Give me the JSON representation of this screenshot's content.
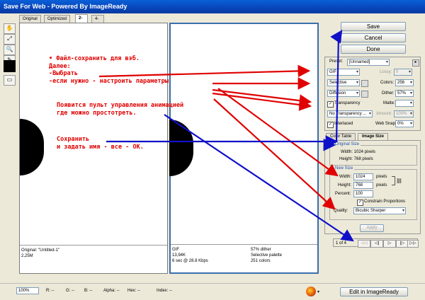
{
  "window": {
    "title": "Save For Web - Powered By ImageReady"
  },
  "tabs": [
    "Original",
    "Optimized",
    "2-Up",
    "4-Up"
  ],
  "left_pane": {
    "caption_line1": "Original: \"Untitled-1\"",
    "caption_line2": "2,25M"
  },
  "right_pane": {
    "caption_left": [
      "GIF",
      "13,94K",
      "6 sec @ 28.8 Kbps"
    ],
    "caption_right": [
      "57% dither",
      "Selective palette",
      "251 colors"
    ]
  },
  "buttons": {
    "save": "Save",
    "cancel": "Cancel",
    "done": "Done"
  },
  "settings": {
    "preset_label": "Preset:",
    "preset_value": "[Unnamed]",
    "format": "GIF",
    "lossy_label": "Lossy:",
    "lossy_value": "0",
    "palette": "Selective",
    "colors_label": "Colors:",
    "colors_value": "256",
    "dither_algo": "Diffusion",
    "dither_label": "Dither:",
    "dither_value": "57%",
    "transparency_label": "Transparency",
    "matte_label": "Matte:",
    "transparency_dither": "No Transparency ...",
    "amount_label": "Amount:",
    "amount_value": "100%",
    "interlaced_label": "Interlaced",
    "websnap_label": "Web Snap:",
    "websnap_value": "0%"
  },
  "panel_tabs": [
    "Color Table",
    "Image Size"
  ],
  "image_size": {
    "original_title": "Original Size",
    "orig_width": "Width: 1024 pixels",
    "orig_height": "Height: 768 pixels",
    "new_title": "New Size",
    "width_label": "Width:",
    "width_value": "1024",
    "height_label": "Height:",
    "height_value": "768",
    "percent_label": "Percent:",
    "percent_value": "100",
    "pixels_unit": "pixels",
    "constrain_label": "Constrain Proportions",
    "quality_label": "Quality:",
    "quality_value": "Bicubic Sharper",
    "apply_label": "Apply"
  },
  "animation": {
    "frame_counter": "1 of 4"
  },
  "statusbar": {
    "zoom": "100%",
    "r": "R: --",
    "g": "G: --",
    "b": "B: --",
    "alpha": "Alpha: --",
    "hex": "Hex: --",
    "index": "Index: --",
    "edit_button": "Edit in ImageReady"
  },
  "annotations": {
    "block1": [
      "•  Файл-сохранить для вэб.",
      "   Далее:",
      "   -Выбрать",
      "   -если нужно - настроить параметры"
    ],
    "block2": [
      "Появится пульт управления анимацией",
      "где можно простотреть."
    ],
    "block3": [
      "Сохранить",
      "и задать имя - все - ОК."
    ]
  },
  "colors": {
    "annotation_red": "#e00000",
    "arrow_blue": "#1010c8",
    "titlebar": "#0845b8"
  }
}
